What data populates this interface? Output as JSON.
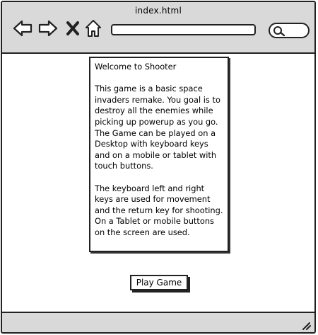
{
  "window": {
    "title": "index.html"
  },
  "toolbar": {
    "back_icon": "arrow-left-icon",
    "forward_icon": "arrow-right-icon",
    "stop_icon": "close-icon",
    "home_icon": "home-icon",
    "search_icon": "search-icon"
  },
  "content": {
    "heading": "Welcome to Shooter",
    "paragraph_1": "This game is a basic space invaders remake. You goal is to destroy all the enemies while picking up powerup as you go. The Game can be played on a Desktop with keyboard keys and on a mobile or tablet with touch buttons.",
    "paragraph_2": "The keyboard left and right keys are used for movement and the return key for shooting. On a Tablet or mobile buttons on the screen are used.",
    "play_button_label": "Play Game"
  },
  "colors": {
    "chrome": "#d9d9d9",
    "border": "#222222",
    "background": "#ffffff"
  }
}
